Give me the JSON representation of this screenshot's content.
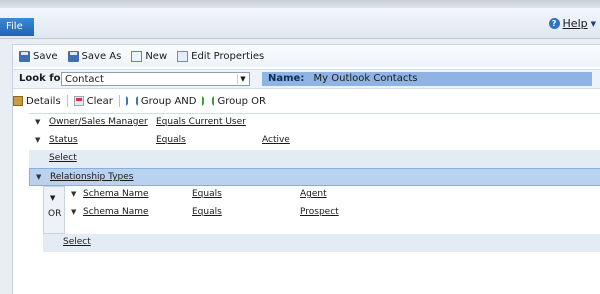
{
  "menu": {
    "file": "File",
    "help": "Help"
  },
  "toolbar": {
    "save": "Save",
    "save_as": "Save As",
    "new": "New",
    "edit_properties": "Edit Properties"
  },
  "lookfor": {
    "label": "Look for:",
    "value": "Contact",
    "name_label": "Name:",
    "name_value": "My Outlook Contacts"
  },
  "actions": {
    "details": "Details",
    "clear": "Clear",
    "group_and": "Group AND",
    "group_or": "Group OR"
  },
  "criteria": {
    "rows": [
      {
        "field": "Owner/Sales Manager",
        "op": "Equals Current User",
        "value": ""
      },
      {
        "field": "Status",
        "op": "Equals",
        "value": "Active"
      }
    ],
    "select1": "Select",
    "related": "Relationship Types",
    "group_label": "OR",
    "group_rows": [
      {
        "field": "Schema Name",
        "op": "Equals",
        "value": "Agent"
      },
      {
        "field": "Schema Name",
        "op": "Equals",
        "value": "Prospect"
      }
    ],
    "select2": "Select"
  }
}
